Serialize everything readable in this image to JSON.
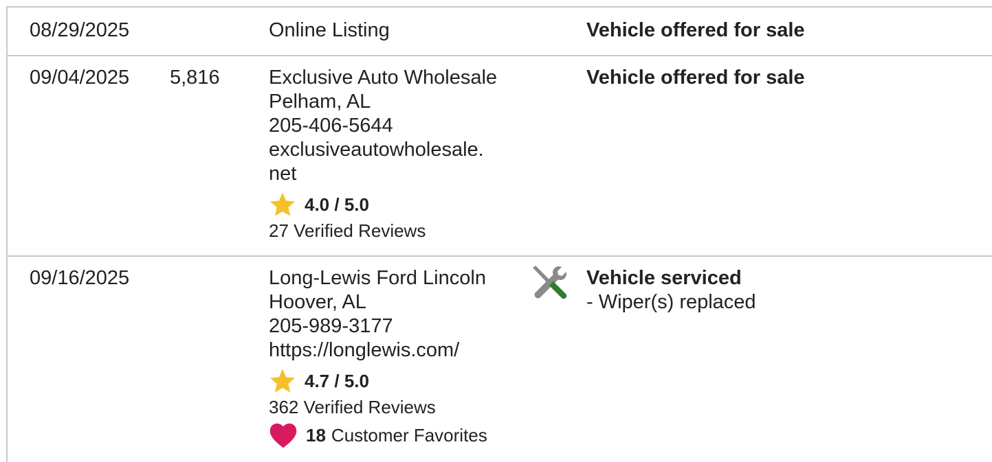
{
  "records": [
    {
      "date": "08/29/2025",
      "mileage": "",
      "source_lines": [
        "Online Listing"
      ],
      "comment_title": "Vehicle offered for sale"
    },
    {
      "date": "09/04/2025",
      "mileage": "5,816",
      "source_lines": [
        "Exclusive Auto Wholesale",
        "Pelham, AL",
        "205-406-5644",
        "exclusiveautowholesale.",
        "net"
      ],
      "rating": "4.0 / 5.0",
      "reviews": "27 Verified Reviews",
      "comment_title": "Vehicle offered for sale"
    },
    {
      "date": "09/16/2025",
      "mileage": "",
      "source_lines": [
        "Long-Lewis Ford Lincoln",
        "Hoover, AL",
        "205-989-3177",
        "https://longlewis.com/"
      ],
      "rating": "4.7 / 5.0",
      "reviews": "362 Verified Reviews",
      "favorites_count": "18",
      "favorites_label": "Customer Favorites",
      "service_icon": "wrench-screwdriver-icon",
      "comment_title": "Vehicle serviced",
      "comment_detail": "- Wiper(s) replaced"
    }
  ],
  "colors": {
    "star": "#f7c02b",
    "heart": "#d81b60",
    "tool_gray": "#8a8a8a",
    "tool_green": "#2e7d32",
    "divider": "#c8c8c8"
  }
}
